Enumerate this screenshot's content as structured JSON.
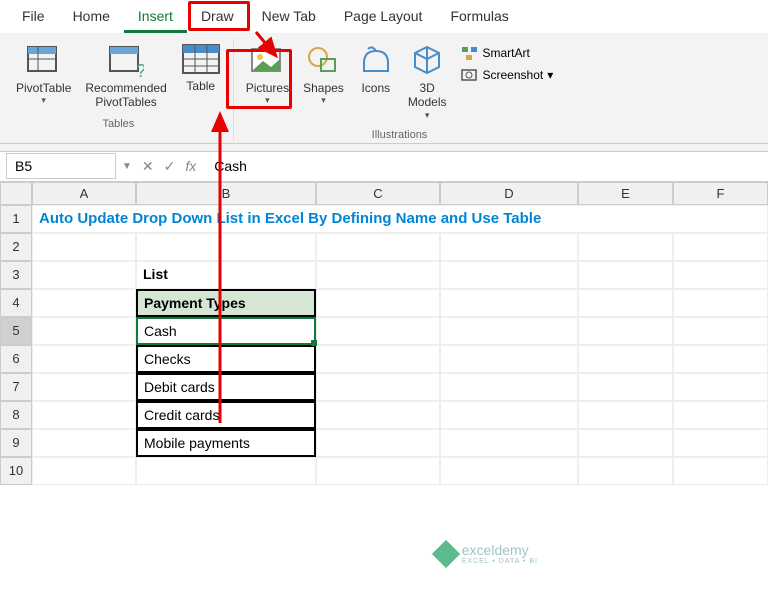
{
  "tabs": [
    "File",
    "Home",
    "Insert",
    "Draw",
    "New Tab",
    "Page Layout",
    "Formulas"
  ],
  "active_tab_index": 2,
  "ribbon": {
    "tables_group": "Tables",
    "illustrations_group": "Illustrations",
    "pivottable": "PivotTable",
    "recommended": "Recommended\nPivotTables",
    "table": "Table",
    "pictures": "Pictures",
    "shapes": "Shapes",
    "icons": "Icons",
    "models3d": "3D\nModels",
    "smartart": "SmartArt",
    "screenshot": "Screenshot"
  },
  "namebox": "B5",
  "fx": "Cash",
  "cols": [
    "A",
    "B",
    "C",
    "D",
    "E",
    "F"
  ],
  "rows": [
    "1",
    "2",
    "3",
    "4",
    "5",
    "6",
    "7",
    "8",
    "9",
    "10"
  ],
  "sheet": {
    "title": "Auto Update Drop Down List in Excel By Defining Name and Use Table",
    "list_label": "List",
    "header": "Payment Types",
    "items": [
      "Cash",
      "Checks",
      "Debit cards",
      "Credit cards",
      "Mobile payments"
    ]
  },
  "watermark": {
    "name": "exceldemy",
    "sub": "EXCEL • DATA • BI"
  }
}
